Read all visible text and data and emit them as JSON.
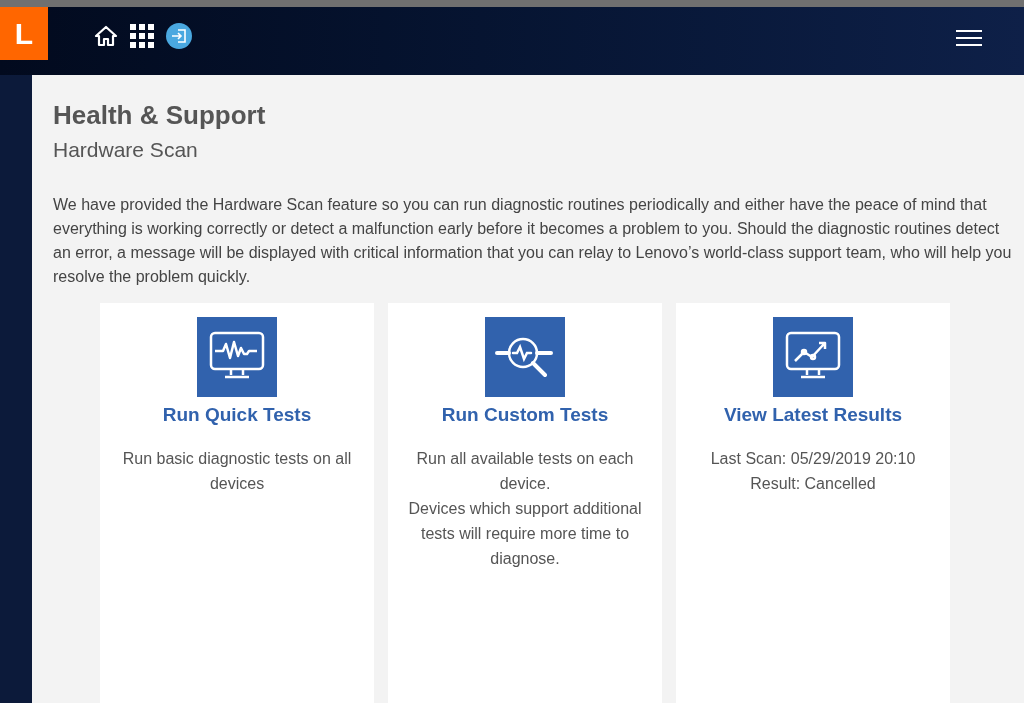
{
  "header": {
    "logo": "L"
  },
  "page": {
    "title": "Health & Support",
    "subtitle": "Hardware Scan",
    "intro": "We have provided the Hardware Scan feature so you can run diagnostic routines periodically and either have the peace of mind that everything is working correctly or detect a malfunction early before it becomes a problem to you. Should the diagnostic routines detect an error, a message will be displayed with critical information that you can relay to Lenovo’s world-class support team, who will help you resolve the problem quickly."
  },
  "cards": [
    {
      "kind": "quick",
      "title": "Run Quick Tests",
      "lines": [
        "Run basic diagnostic tests on all devices"
      ]
    },
    {
      "kind": "custom",
      "title": "Run Custom Tests",
      "lines": [
        "Run all available tests on each device.",
        "Devices which support additional tests will require more time to diagnose."
      ]
    },
    {
      "kind": "results",
      "title": "View Latest Results",
      "lines": [
        "Last Scan: 05/29/2019 20:10",
        "Result: Cancelled"
      ]
    }
  ]
}
